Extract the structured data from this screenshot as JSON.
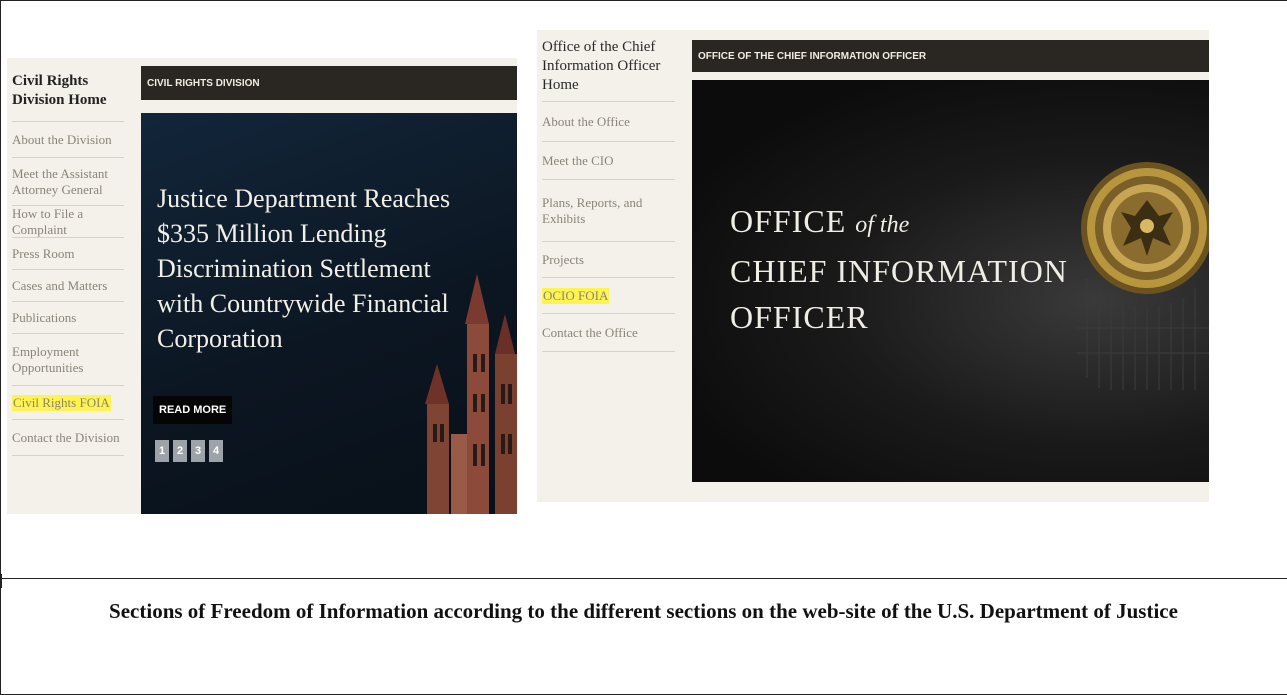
{
  "panel1": {
    "header_bar": "CIVIL RIGHTS DIVISION",
    "nav_home": "Civil Rights Division Home",
    "nav_items": [
      "About the Division",
      "Meet the Assistant Attorney General",
      "How to File a Complaint",
      "Press Room",
      "Cases and Matters",
      "Publications",
      "Employment Opportunities",
      "Civil Rights FOIA",
      "Contact the Division"
    ],
    "highlighted_item": "Civil Rights FOIA",
    "headline": "Justice Department Reaches $335 Million Lending Discrimination Settlement with Countrywide Financial Corporation",
    "read_more": "READ MORE",
    "pages": [
      "1",
      "2",
      "3",
      "4"
    ]
  },
  "panel2": {
    "header_bar": "OFFICE OF THE CHIEF INFORMATION OFFICER",
    "nav_home": "Office of the Chief Information Officer Home",
    "nav_items": [
      "About the Office",
      "Meet the CIO",
      "Plans, Reports, and Exhibits",
      "Projects",
      "OCIO FOIA",
      "Contact the Office"
    ],
    "highlighted_item": "OCIO FOIA",
    "hero_line1": "OFFICE",
    "hero_of_the": "of the",
    "hero_line2": "CHIEF INFORMATION",
    "hero_line3": "OFFICER"
  },
  "caption": "Sections of Freedom of Information according to the different sections on the web-site of the U.S. Department of Justice",
  "colors": {
    "highlight": "#fff44f",
    "header_bar": "#2a2723",
    "nav_bg": "#f3f1ea",
    "nav_text": "#8a8478"
  },
  "icons": {
    "seal": "department-of-justice-seal"
  }
}
